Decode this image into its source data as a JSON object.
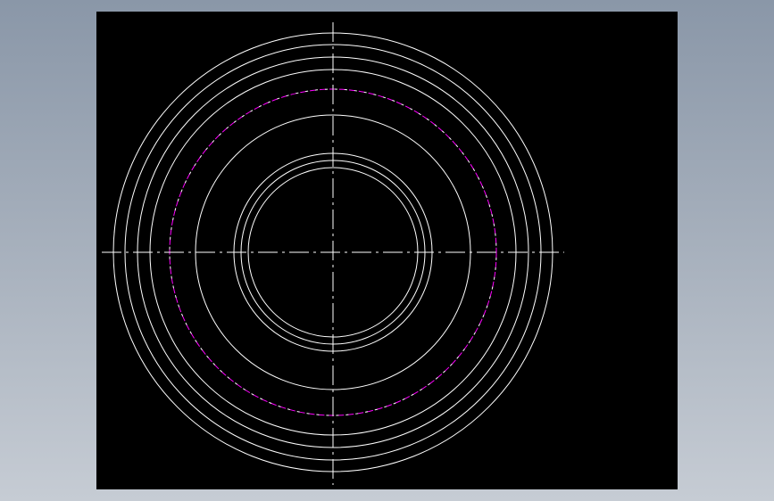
{
  "drawing": {
    "background_color": "#000000",
    "window_background": "#9aa5b3",
    "line_color": "#ffffff",
    "hidden_line_color": "#ff00ff",
    "centerline_style": "dash-dot",
    "circles": [
      {
        "role": "outer-edge",
        "style": "solid"
      },
      {
        "role": "outer-ring-2",
        "style": "solid"
      },
      {
        "role": "outer-ring-3",
        "style": "solid"
      },
      {
        "role": "outer-ring-4",
        "style": "solid"
      },
      {
        "role": "hidden-edge",
        "style": "dashed"
      },
      {
        "role": "middle-ring",
        "style": "solid"
      },
      {
        "role": "inner-ring-1",
        "style": "solid"
      },
      {
        "role": "inner-ring-2",
        "style": "solid"
      },
      {
        "role": "bore",
        "style": "solid"
      }
    ]
  }
}
